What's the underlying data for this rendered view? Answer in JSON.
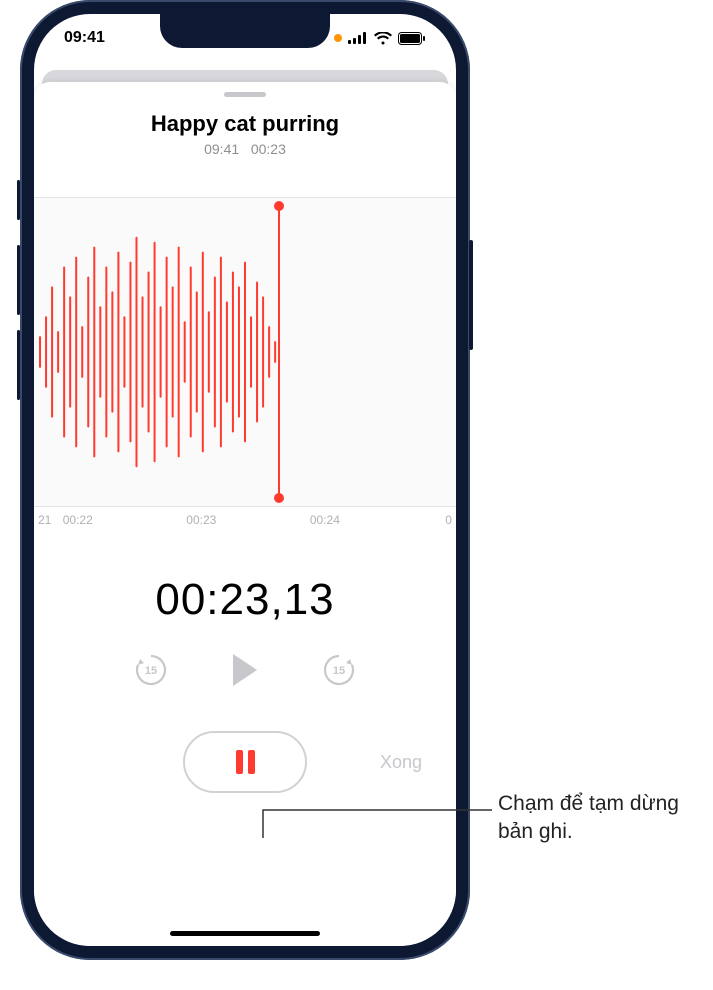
{
  "status": {
    "time": "09:41"
  },
  "recording": {
    "title": "Happy cat purring",
    "time_of_day": "09:41",
    "duration_short": "00:23",
    "timer": "00:23,13",
    "done_label": "Xong"
  },
  "ruler": {
    "t0": "21",
    "t1": "00:22",
    "t2": "00:23",
    "t3": "00:24",
    "t4": "0"
  },
  "callout": {
    "text": "Chạm để tạm dừng bản ghi."
  }
}
